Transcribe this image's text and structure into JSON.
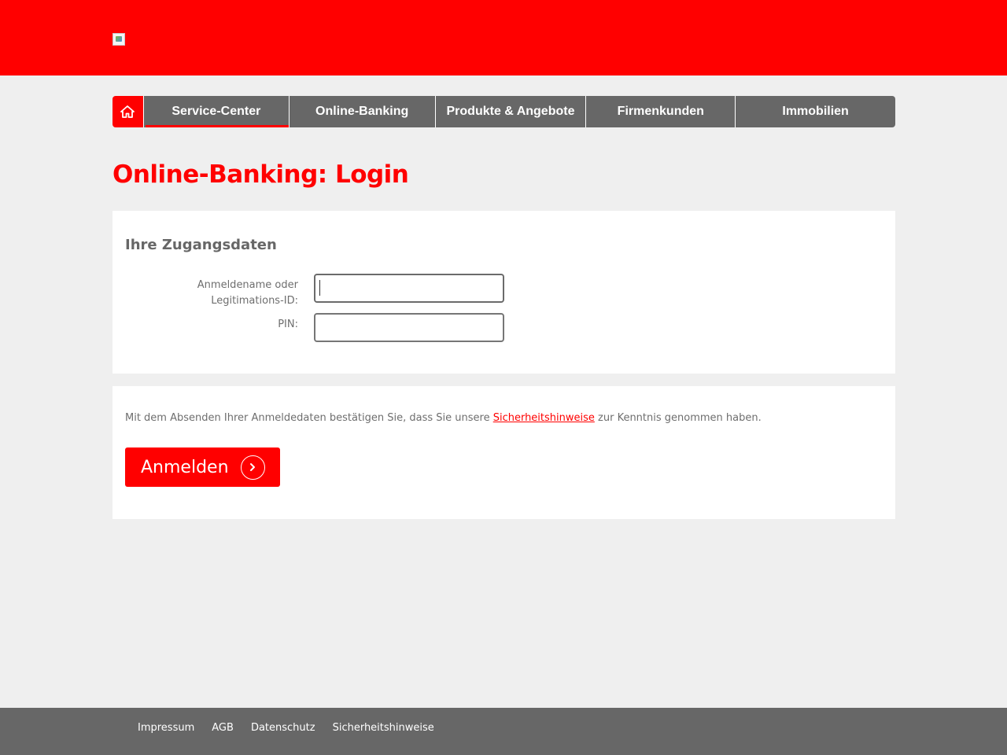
{
  "header": {
    "logo_icon": "broken-image-icon",
    "brand_color": "#ff0000"
  },
  "nav": {
    "home_icon": "home-icon",
    "items": [
      {
        "label": "Service-Center",
        "active": true
      },
      {
        "label": "Online-Banking",
        "active": false
      },
      {
        "label": "Produkte & Angebote",
        "active": false
      },
      {
        "label": "Firmenkunden",
        "active": false
      },
      {
        "label": "Immobilien",
        "active": false
      }
    ]
  },
  "page": {
    "title": "Online-Banking: Login"
  },
  "credentials": {
    "section_title": "Ihre Zugangsdaten",
    "username_label_line1": "Anmeldename oder",
    "username_label_line2": "Legitimations-ID:",
    "username_value": "",
    "pin_label": "PIN:",
    "pin_value": ""
  },
  "submit": {
    "consent_before": "Mit dem Absenden Ihrer Anmeldedaten bestätigen Sie, dass Sie unsere ",
    "consent_link": "Sicherheitshinweise",
    "consent_after": " zur Kenntnis genommen haben.",
    "login_label": "Anmelden",
    "login_icon": "chevron-right-icon"
  },
  "footer": {
    "links": [
      "Impressum",
      "AGB",
      "Datenschutz",
      "Sicherheitshinweise"
    ]
  }
}
